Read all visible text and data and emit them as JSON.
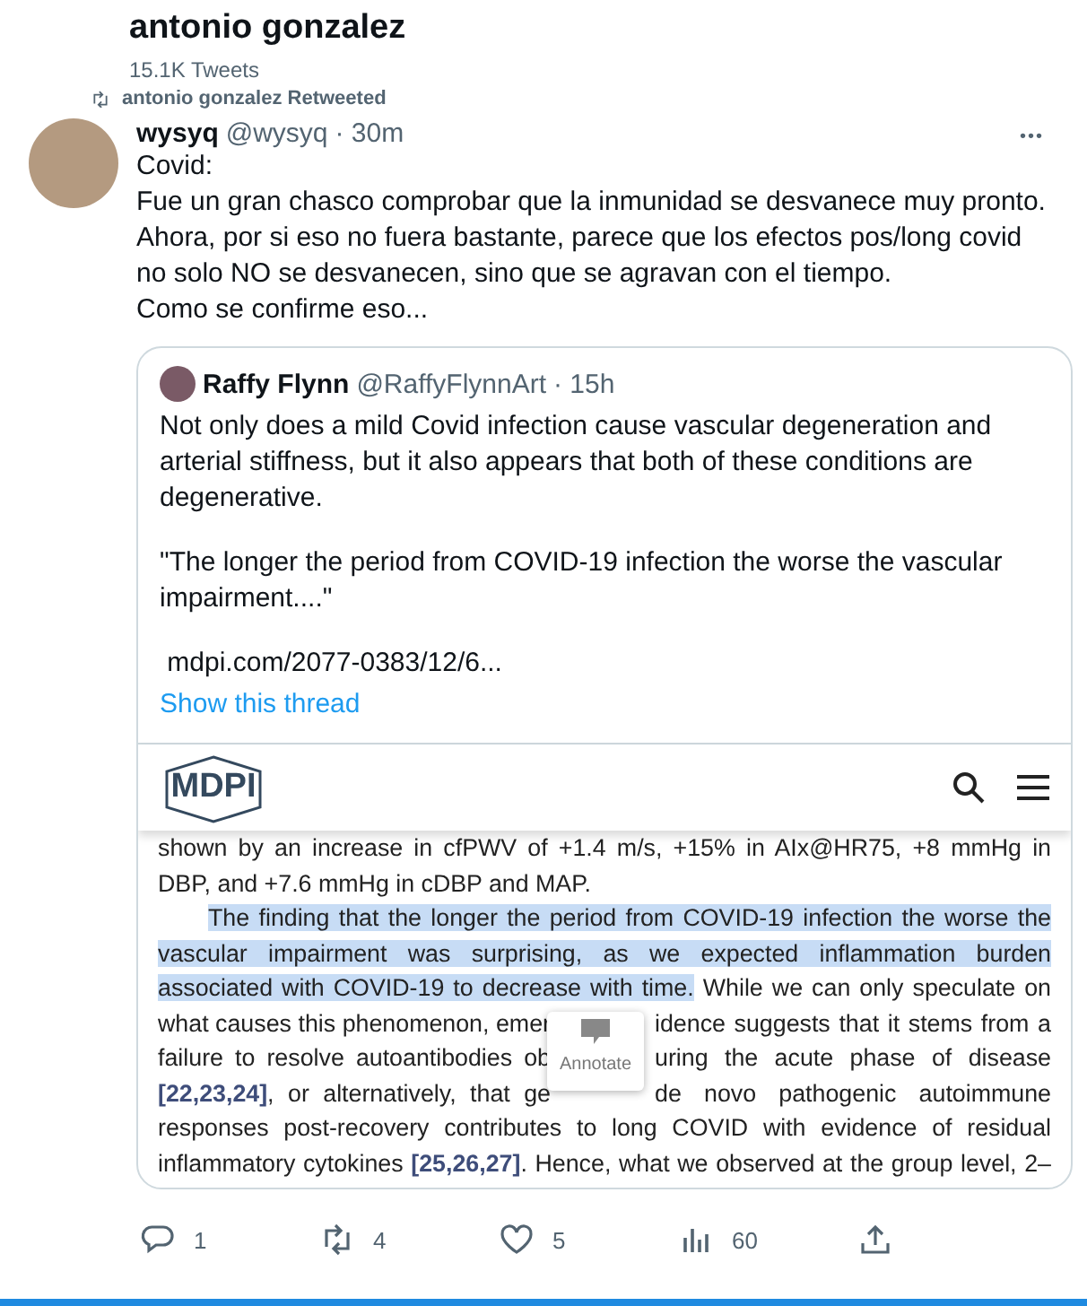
{
  "profile_header": {
    "name": "antonio gonzalez",
    "tweet_count": "15.1K Tweets"
  },
  "retweet_note": "antonio gonzalez Retweeted",
  "tweet": {
    "name": "wysyq",
    "handle": "@wysyq",
    "time": "· 30m",
    "more": "•••",
    "lines": [
      "Covid:",
      "Fue un gran chasco comprobar que la inmunidad se desvanece muy pronto.",
      "Ahora, por si eso no fuera bastante, parece que los efectos pos/long covid",
      "no solo NO se desvanecen, sino que se agravan con el tiempo.",
      "Como se confirme eso..."
    ],
    "quote": {
      "name": "Raffy Flynn",
      "handle": "@RaffyFlynnArt",
      "time": "· 15h",
      "paragraphs": [
        "Not only does a mild Covid infection cause vascular degeneration and arterial stiffness, but it also appears that both of these conditions are degenerative.",
        "\"The longer the period from COVID-19 infection the worse the vascular impairment....\"",
        " mdpi.com/2077-0383/12/6..."
      ],
      "thread_link": "Show this thread",
      "article": {
        "logo": "MDPI",
        "popup_label": "Annotate",
        "lines": [
          {
            "kind": "justify",
            "segments": [
              {
                "kind": "plain",
                "text": "shown by an increase in cfPWV of +1.4 m/s, +15% in AIx@HR75, +8 mmHg in"
              }
            ]
          },
          {
            "kind": "end",
            "segments": [
              {
                "kind": "plain",
                "text": "DBP, and +7.6 mmHg in cDBP and MAP."
              }
            ]
          },
          {
            "kind": "first",
            "segments": [
              {
                "kind": "highlight",
                "text": "The finding that the longer the period from COVID-19 infection the worse the"
              }
            ]
          },
          {
            "kind": "justify",
            "segments": [
              {
                "kind": "highlight",
                "text": "vascular impairment was surprising, as we expected inflammation burden"
              }
            ]
          },
          {
            "kind": "justify",
            "segments": [
              {
                "kind": "highlight",
                "text": "associated with COVID-19 to decrease with time."
              },
              {
                "kind": "plain",
                "text": " While we can only speculate on"
              }
            ]
          },
          {
            "kind": "split",
            "segments": [
              {
                "kind": "plain",
                "text": "what causes this phenomenon, emer"
              },
              {
                "kind": "gap"
              },
              {
                "kind": "plain",
                "text": "idence suggests that it stems from a"
              }
            ]
          },
          {
            "kind": "split",
            "segments": [
              {
                "kind": "plain",
                "text": "failure to resolve autoantibodies ob"
              },
              {
                "kind": "gap"
              },
              {
                "kind": "plain",
                "text": "uring the acute phase of disease"
              }
            ]
          },
          {
            "kind": "split",
            "segments": [
              {
                "kind": "ref",
                "text": "[22,23,24]"
              },
              {
                "kind": "plain",
                "text": ", or alternatively, that ge"
              },
              {
                "kind": "gap"
              },
              {
                "kind": "plain",
                "text": "de novo pathogenic autoimmune"
              }
            ]
          },
          {
            "kind": "justify",
            "segments": [
              {
                "kind": "plain",
                "text": "responses post-recovery contributes to long COVID with evidence of residual"
              }
            ]
          },
          {
            "kind": "justify",
            "segments": [
              {
                "kind": "plain",
                "text": "inflammatory cytokines "
              },
              {
                "kind": "ref",
                "text": "[25,26,27]"
              },
              {
                "kind": "plain",
                "text": ". Hence, what we observed at the group level, 2–"
              }
            ]
          }
        ]
      }
    },
    "actions": [
      {
        "kind": "reply",
        "count": "1"
      },
      {
        "kind": "retweet",
        "count": "4"
      },
      {
        "kind": "like",
        "count": "5"
      },
      {
        "kind": "views",
        "count": "60"
      },
      {
        "kind": "share"
      }
    ]
  }
}
